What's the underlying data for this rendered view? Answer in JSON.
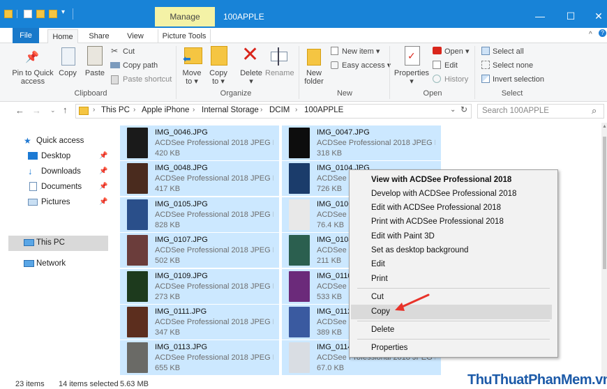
{
  "titlebar": {
    "manage": "Manage",
    "title": "100APPLE",
    "minimize": "—",
    "maximize": "☐",
    "close": "✕"
  },
  "tabs": {
    "file": "File",
    "home": "Home",
    "share": "Share",
    "view": "View",
    "picture_tools": "Picture Tools"
  },
  "ribbon": {
    "clipboard": {
      "pin": "Pin to Quick",
      "pin2": "access",
      "copy": "Copy",
      "paste": "Paste",
      "cut": "Cut",
      "copy_path": "Copy path",
      "paste_shortcut": "Paste shortcut",
      "label": "Clipboard"
    },
    "organize": {
      "move_to": "Move",
      "move_to2": "to ▾",
      "copy_to": "Copy",
      "copy_to2": "to ▾",
      "delete": "Delete",
      "delete2": "▾",
      "rename": "Rename",
      "label": "Organize"
    },
    "new": {
      "new_folder": "New",
      "new_folder2": "folder",
      "new_item": "New item ▾",
      "easy_access": "Easy access ▾",
      "label": "New"
    },
    "open": {
      "properties": "Properties",
      "properties2": "▾",
      "open": "Open ▾",
      "edit": "Edit",
      "history": "History",
      "label": "Open"
    },
    "select": {
      "select_all": "Select all",
      "select_none": "Select none",
      "invert": "Invert selection",
      "label": "Select"
    }
  },
  "address": {
    "crumbs": [
      "This PC",
      "Apple iPhone",
      "Internal Storage",
      "DCIM",
      "100APPLE"
    ],
    "search_placeholder": "Search 100APPLE"
  },
  "nav": {
    "quick_access": "Quick access",
    "desktop": "Desktop",
    "downloads": "Downloads",
    "documents": "Documents",
    "pictures": "Pictures",
    "this_pc": "This PC",
    "network": "Network"
  },
  "files": [
    {
      "name": "IMG_0046.JPG",
      "desc": "ACDSee Professional 2018 JPEG I...",
      "size": "420 KB"
    },
    {
      "name": "IMG_0047.JPG",
      "desc": "ACDSee Professional 2018 JPEG I...",
      "size": "318 KB"
    },
    {
      "name": "IMG_0048.JPG",
      "desc": "ACDSee Professional 2018 JPEG I...",
      "size": "417 KB"
    },
    {
      "name": "IMG_0104.JPG",
      "desc": "ACDSee Professional 2018 JPEG I...",
      "size": "726 KB"
    },
    {
      "name": "IMG_0105.JPG",
      "desc": "ACDSee Professional 2018 JPEG I...",
      "size": "828 KB"
    },
    {
      "name": "IMG_0106.JPG",
      "desc": "ACDSee Professional 2018 JPEG I...",
      "size": "76.4 KB"
    },
    {
      "name": "IMG_0107.JPG",
      "desc": "ACDSee Professional 2018 JPEG I...",
      "size": "502 KB"
    },
    {
      "name": "IMG_0108.JPG",
      "desc": "ACDSee Professional 2018 JPEG I...",
      "size": "211 KB"
    },
    {
      "name": "IMG_0109.JPG",
      "desc": "ACDSee Professional 2018 JPEG I...",
      "size": "273 KB"
    },
    {
      "name": "IMG_0110.JPG",
      "desc": "ACDSee Professional 2018 JPEG I...",
      "size": "533 KB"
    },
    {
      "name": "IMG_0111.JPG",
      "desc": "ACDSee Professional 2018 JPEG I...",
      "size": "347 KB"
    },
    {
      "name": "IMG_0112.JPG",
      "desc": "ACDSee Professional 2018 JPEG I...",
      "size": "389 KB"
    },
    {
      "name": "IMG_0113.JPG",
      "desc": "ACDSee Professional 2018 JPEG I...",
      "size": "655 KB"
    },
    {
      "name": "IMG_0114.JPG",
      "desc": "ACDSee Professional 2018 JPEG I...",
      "size": "67.0 KB"
    }
  ],
  "context_menu": {
    "view_acdsee": "View with ACDSee Professional 2018",
    "develop": "Develop with ACDSee Professional 2018",
    "edit_acdsee": "Edit with ACDSee Professional 2018",
    "print_acdsee": "Print with ACDSee Professional 2018",
    "paint3d": "Edit with Paint 3D",
    "desktop_bg": "Set as desktop background",
    "edit": "Edit",
    "print": "Print",
    "cut": "Cut",
    "copy": "Copy",
    "delete": "Delete",
    "properties": "Properties"
  },
  "status": {
    "items": "23 items",
    "selected": "14 items selected",
    "size": "5.63 MB"
  },
  "watermark": "ThuThuatPhanMem.vn",
  "colors": {
    "accent": "#1883d7",
    "selection": "#cce8ff",
    "arrow": "#e8332a"
  }
}
